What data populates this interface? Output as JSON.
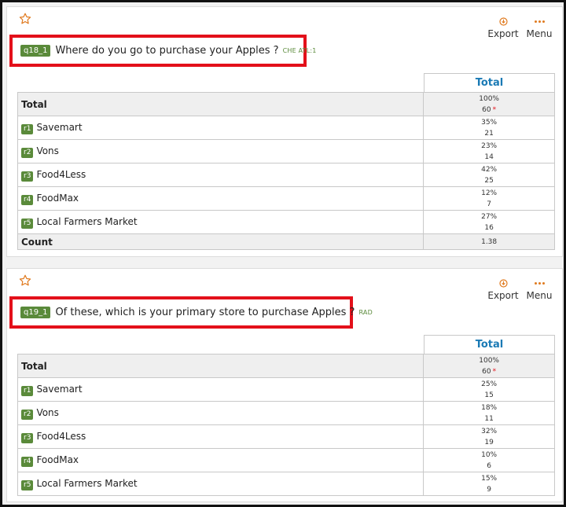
{
  "colors": {
    "accent": "#e07a1f",
    "highlight_border": "#e3101a",
    "tag_green": "#5a8a3a",
    "header_blue": "#1a7ab5"
  },
  "toolbar": {
    "export_label": "Export",
    "menu_label": "Menu"
  },
  "questions": [
    {
      "id": "q18_1",
      "text": "Where do you go to purchase your Apples ?",
      "tags": "CHE  ATL:1",
      "column_header": "Total",
      "total": {
        "label": "Total",
        "pct": "100%",
        "n": "60",
        "marker": "*"
      },
      "rows": [
        {
          "id": "r1",
          "label": "Savemart",
          "pct": "35%",
          "n": "21"
        },
        {
          "id": "r2",
          "label": "Vons",
          "pct": "23%",
          "n": "14"
        },
        {
          "id": "r3",
          "label": "Food4Less",
          "pct": "42%",
          "n": "25"
        },
        {
          "id": "r4",
          "label": "FoodMax",
          "pct": "12%",
          "n": "7"
        },
        {
          "id": "r5",
          "label": "Local Farmers Market",
          "pct": "27%",
          "n": "16"
        }
      ],
      "count": {
        "label": "Count",
        "value": "1.38"
      }
    },
    {
      "id": "q19_1",
      "text": "Of these, which is your primary store to purchase Apples ?",
      "tags": "RAD",
      "column_header": "Total",
      "total": {
        "label": "Total",
        "pct": "100%",
        "n": "60",
        "marker": "*"
      },
      "rows": [
        {
          "id": "r1",
          "label": "Savemart",
          "pct": "25%",
          "n": "15"
        },
        {
          "id": "r2",
          "label": "Vons",
          "pct": "18%",
          "n": "11"
        },
        {
          "id": "r3",
          "label": "Food4Less",
          "pct": "32%",
          "n": "19"
        },
        {
          "id": "r4",
          "label": "FoodMax",
          "pct": "10%",
          "n": "6"
        },
        {
          "id": "r5",
          "label": "Local Farmers Market",
          "pct": "15%",
          "n": "9"
        }
      ]
    }
  ]
}
